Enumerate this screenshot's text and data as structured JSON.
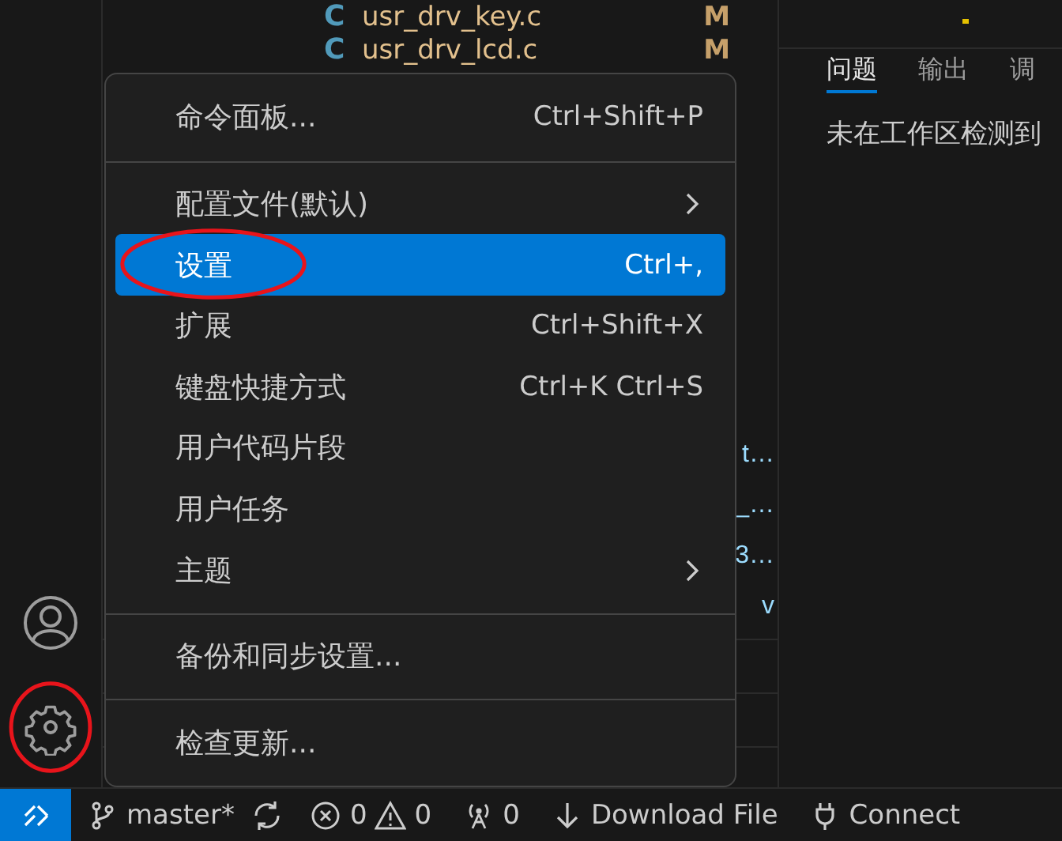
{
  "explorer": {
    "files": [
      {
        "icon": "C",
        "name": "usr_drv_key.c",
        "badge": "M"
      },
      {
        "icon": "C",
        "name": "usr_drv_lcd.c",
        "badge": "M"
      }
    ],
    "clipped_rows": [
      "t…",
      "_…",
      "3…",
      "v"
    ]
  },
  "panel": {
    "tabs": [
      {
        "label": "问题",
        "selected": true
      },
      {
        "label": "输出",
        "selected": false
      },
      {
        "label": "调",
        "selected": false
      }
    ],
    "message": "未在工作区检测到"
  },
  "activity_bar": {
    "account_circled": false,
    "settings_circled": true
  },
  "menu": [
    {
      "kind": "item",
      "label": "命令面板...",
      "shortcut": "Ctrl+Shift+P",
      "selected": false,
      "circled": false
    },
    {
      "kind": "separator"
    },
    {
      "kind": "item",
      "label": "配置文件(默认)",
      "submenu": true,
      "selected": false,
      "circled": false
    },
    {
      "kind": "item",
      "label": "设置",
      "shortcut": "Ctrl+,",
      "selected": true,
      "circled": true
    },
    {
      "kind": "item",
      "label": "扩展",
      "shortcut": "Ctrl+Shift+X",
      "selected": false,
      "circled": false
    },
    {
      "kind": "item",
      "label": "键盘快捷方式",
      "shortcut": "Ctrl+K Ctrl+S",
      "selected": false,
      "circled": false
    },
    {
      "kind": "item",
      "label": "用户代码片段",
      "selected": false,
      "circled": false
    },
    {
      "kind": "item",
      "label": "用户任务",
      "selected": false,
      "circled": false
    },
    {
      "kind": "item",
      "label": "主题",
      "submenu": true,
      "selected": false,
      "circled": false
    },
    {
      "kind": "separator"
    },
    {
      "kind": "item",
      "label": "备份和同步设置...",
      "selected": false,
      "circled": false
    },
    {
      "kind": "separator"
    },
    {
      "kind": "item",
      "label": "检查更新...",
      "selected": false,
      "circled": false
    }
  ],
  "status_bar": {
    "branch": "master*",
    "errors": "0",
    "warnings": "0",
    "ports": "0",
    "download": "Download File",
    "connect": "Connect"
  }
}
